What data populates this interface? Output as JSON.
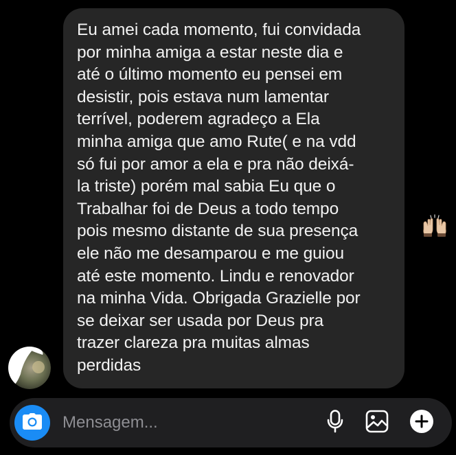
{
  "message": {
    "lines": [
      "Eu amei cada momento, fui convidada",
      "por minha amiga a estar neste dia e",
      "até o último momento eu pensei em",
      "desistir, pois estava num lamentar",
      "terrível, poderem agradeço a Ela",
      "minha amiga que amo Rute( e na vdd",
      "só fui por amor a ela e pra não deixá-",
      "la triste) porém mal sabia Eu que o",
      "Trabalhar foi de Deus a todo tempo",
      "pois mesmo distante de sua presença",
      "ele não me desamparou e me guiou",
      "até este momento. Lindu e renovador",
      "na minha Vida. Obrigada Grazielle por",
      "se deixar ser usada por Deus pra",
      "trazer clareza pra muitas almas",
      "perdidas"
    ],
    "emoji": "raising-hands-emoji"
  },
  "composer": {
    "placeholder": "Mensagem...",
    "value": ""
  },
  "icons": {
    "camera": "camera-icon",
    "mic": "microphone-icon",
    "gallery": "image-icon",
    "plus": "plus-circle-icon"
  },
  "colors": {
    "background": "#000000",
    "bubble": "#262626",
    "composer": "#1f1f21",
    "accent": "#1a8cf5",
    "text": "#f2f2f2",
    "placeholder": "#8e8e93"
  }
}
